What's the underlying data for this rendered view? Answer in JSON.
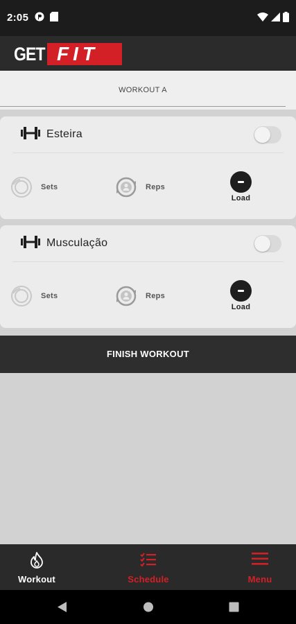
{
  "status_bar": {
    "time": "2:05"
  },
  "app": {
    "logo_left": "GET",
    "logo_right": "FIT"
  },
  "header": {
    "title": "WORKOUT A"
  },
  "exercises": [
    {
      "name": "Esteira",
      "sets_label": "Sets",
      "reps_label": "Reps",
      "load_label": "Load",
      "enabled": false
    },
    {
      "name": "Musculação",
      "sets_label": "Sets",
      "reps_label": "Reps",
      "load_label": "Load",
      "enabled": false
    }
  ],
  "finish_button": {
    "label": "FINISH WORKOUT"
  },
  "bottom_nav": {
    "items": [
      {
        "label": "Workout",
        "icon": "flame-icon",
        "active": true
      },
      {
        "label": "Schedule",
        "icon": "checklist-icon",
        "active": false
      },
      {
        "label": "Menu",
        "icon": "hamburger-icon",
        "active": false
      }
    ],
    "active_color": "#ffffff",
    "inactive_color": "#d32026"
  },
  "colors": {
    "brand_red": "#d32026",
    "dark": "#2b2b2b",
    "background": "#d2d2d2"
  }
}
